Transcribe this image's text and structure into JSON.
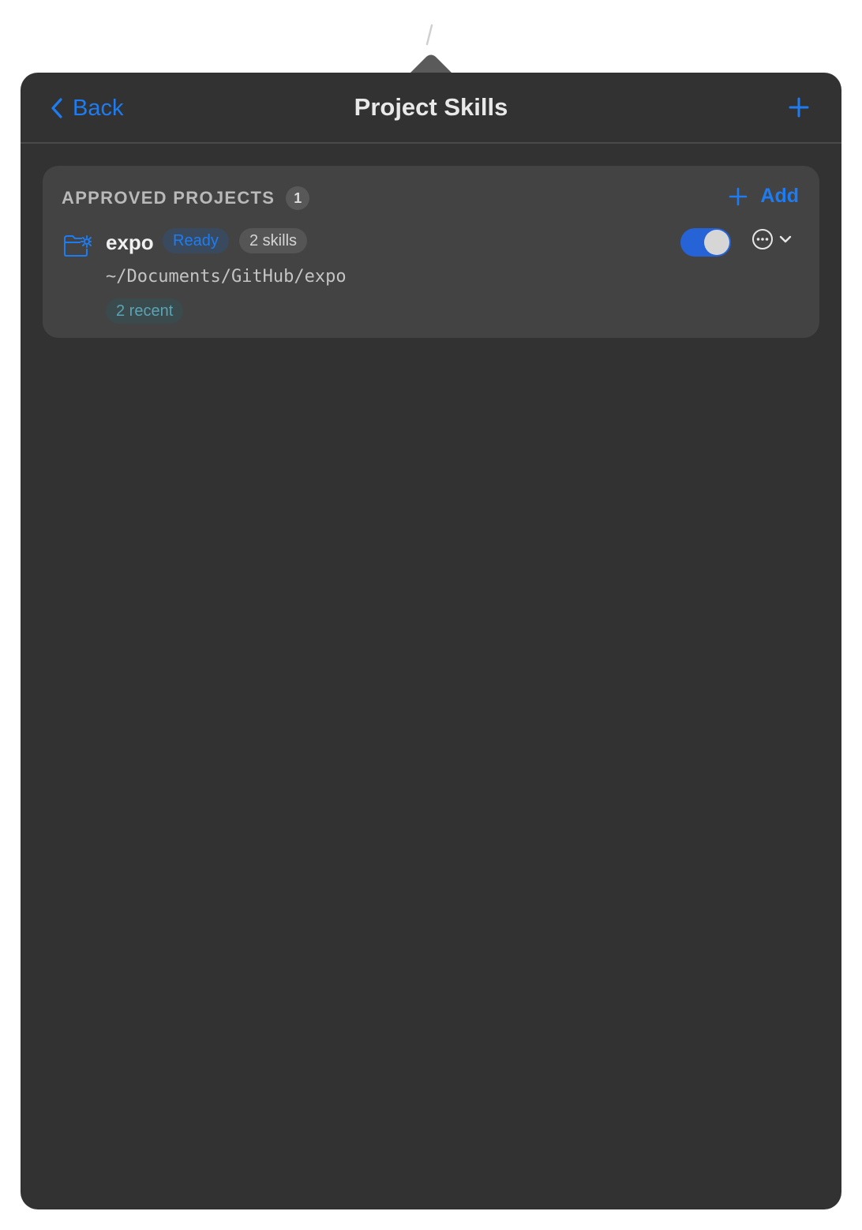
{
  "header": {
    "back_label": "Back",
    "title": "Project Skills"
  },
  "section": {
    "title": "APPROVED PROJECTS",
    "count": "1",
    "add_label": "Add"
  },
  "projects": [
    {
      "name": "expo",
      "status": "Ready",
      "skills": "2 skills",
      "path": "~/Documents/GitHub/expo",
      "recent": "2 recent",
      "enabled": true
    }
  ],
  "colors": {
    "accent": "#1e7cf2",
    "panel_bg": "#323232",
    "card_bg": "#434343",
    "toggle_on": "#2563d6"
  },
  "icons": {
    "back": "chevron-left-icon",
    "add_header": "plus-icon",
    "add_section": "plus-icon",
    "project": "folder-gear-icon",
    "more": "ellipsis-circle-icon",
    "dropdown": "chevron-down-icon"
  }
}
